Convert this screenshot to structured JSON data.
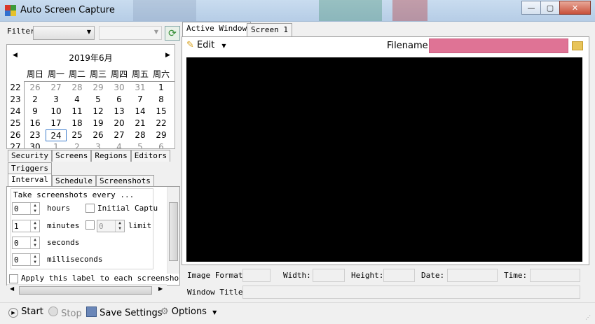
{
  "window": {
    "title": "Auto Screen Capture",
    "minimize": "—",
    "maximize": "▢",
    "close": "✕"
  },
  "filter": {
    "label": "Filter",
    "value": "",
    "value2": ""
  },
  "calendar": {
    "month_title": "2019年6月",
    "weekdays": [
      "周日",
      "周一",
      "周二",
      "周三",
      "周四",
      "周五",
      "周六"
    ],
    "weeks": [
      {
        "num": "22",
        "days": [
          {
            "d": "26",
            "o": true
          },
          {
            "d": "27",
            "o": true
          },
          {
            "d": "28",
            "o": true
          },
          {
            "d": "29",
            "o": true
          },
          {
            "d": "30",
            "o": true
          },
          {
            "d": "31",
            "o": true
          },
          {
            "d": "1",
            "o": false
          }
        ]
      },
      {
        "num": "23",
        "days": [
          {
            "d": "2",
            "o": false
          },
          {
            "d": "3",
            "o": false
          },
          {
            "d": "4",
            "o": false
          },
          {
            "d": "5",
            "o": false
          },
          {
            "d": "6",
            "o": false
          },
          {
            "d": "7",
            "o": false
          },
          {
            "d": "8",
            "o": false
          }
        ]
      },
      {
        "num": "24",
        "days": [
          {
            "d": "9",
            "o": false
          },
          {
            "d": "10",
            "o": false
          },
          {
            "d": "11",
            "o": false
          },
          {
            "d": "12",
            "o": false
          },
          {
            "d": "13",
            "o": false
          },
          {
            "d": "14",
            "o": false
          },
          {
            "d": "15",
            "o": false
          }
        ]
      },
      {
        "num": "25",
        "days": [
          {
            "d": "16",
            "o": false
          },
          {
            "d": "17",
            "o": false
          },
          {
            "d": "18",
            "o": false
          },
          {
            "d": "19",
            "o": false
          },
          {
            "d": "20",
            "o": false
          },
          {
            "d": "21",
            "o": false
          },
          {
            "d": "22",
            "o": false
          }
        ]
      },
      {
        "num": "26",
        "days": [
          {
            "d": "23",
            "o": false
          },
          {
            "d": "24",
            "o": false,
            "today": true
          },
          {
            "d": "25",
            "o": false
          },
          {
            "d": "26",
            "o": false
          },
          {
            "d": "27",
            "o": false
          },
          {
            "d": "28",
            "o": false
          },
          {
            "d": "29",
            "o": false
          }
        ]
      },
      {
        "num": "27",
        "days": [
          {
            "d": "30",
            "o": false
          },
          {
            "d": "1",
            "o": true
          },
          {
            "d": "2",
            "o": true
          },
          {
            "d": "3",
            "o": true
          },
          {
            "d": "4",
            "o": true
          },
          {
            "d": "5",
            "o": true
          },
          {
            "d": "6",
            "o": true
          }
        ]
      }
    ]
  },
  "tabs_row1": [
    "Security",
    "Screens",
    "Regions",
    "Editors"
  ],
  "tabs_row2": [
    "Triggers"
  ],
  "tabs_row3": [
    "Interval",
    "Schedule",
    "Screenshots"
  ],
  "interval": {
    "caption": "Take screenshots every ...",
    "hours_value": "0",
    "hours_label": "hours",
    "minutes_value": "1",
    "minutes_label": "minutes",
    "seconds_value": "0",
    "seconds_label": "seconds",
    "ms_value": "0",
    "ms_label": "milliseconds",
    "initial_capture_label": "Initial Captu",
    "limit_value": "0",
    "limit_label": "limit",
    "apply_label_text": "Apply this label to each screensho"
  },
  "right_tabs": [
    "Active Window",
    "Screen 1"
  ],
  "editor": {
    "edit_label": "Edit",
    "filename_label": "Filename:",
    "filename_value": ""
  },
  "info": {
    "image_format_label": "Image Format:",
    "width_label": "Width:",
    "height_label": "Height:",
    "date_label": "Date:",
    "time_label": "Time:",
    "window_title_label": "Window Title:"
  },
  "statusbar": {
    "start": "Start",
    "stop": "Stop",
    "save_settings": "Save Settings",
    "options": "Options"
  },
  "colors": {
    "filename_bg": "#df7395",
    "preview_bg": "#000000",
    "today_border": "#3f7ecc"
  }
}
